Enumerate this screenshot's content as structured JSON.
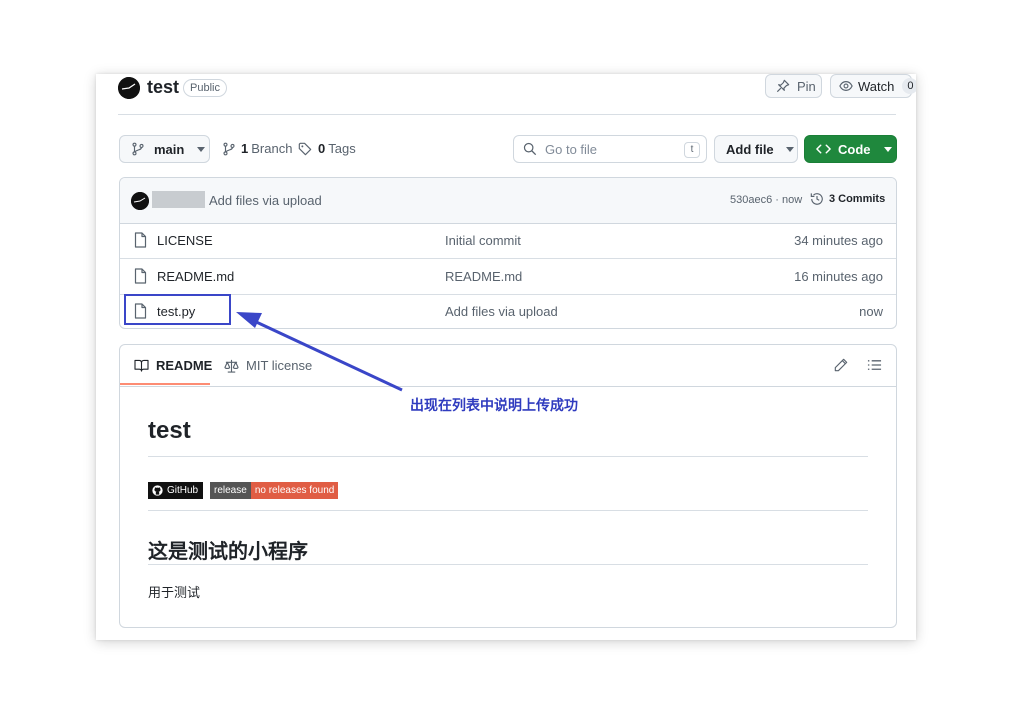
{
  "repo": {
    "name": "test",
    "visibility": "Public",
    "pin_label": "Pin",
    "watch_label": "Watch",
    "watch_count": "0"
  },
  "toolbar": {
    "branch": "main",
    "branch_count": "1",
    "branch_label": "Branch",
    "tag_count": "0",
    "tag_label": "Tags",
    "goto_placeholder": "Go to file",
    "goto_shortcut": "t",
    "add_file": "Add file",
    "code": "Code"
  },
  "latest_commit": {
    "message": "Add files via upload",
    "hash": "530aec6 · now",
    "commits_count": "3",
    "commits_label": "Commits"
  },
  "files": [
    {
      "name": "LICENSE",
      "message": "Initial commit",
      "time": "34 minutes ago"
    },
    {
      "name": "README.md",
      "message": "README.md",
      "time": "16 minutes ago"
    },
    {
      "name": "test.py",
      "message": "Add files via upload",
      "time": "now"
    }
  ],
  "readme": {
    "tab_readme": "README",
    "tab_license": "MIT license",
    "title": "test",
    "badge_github": "GitHub",
    "badge_release_label": "release",
    "badge_release_value": "no releases found",
    "heading2": "这是测试的小程序",
    "paragraph": "用于测试"
  },
  "annotation": {
    "text": "出现在列表中说明上传成功"
  },
  "colors": {
    "accent_green": "#1f883d",
    "annotation_blue": "#3a46c8",
    "release_orange": "#e05d44",
    "tab_underline": "#fd8c73"
  }
}
